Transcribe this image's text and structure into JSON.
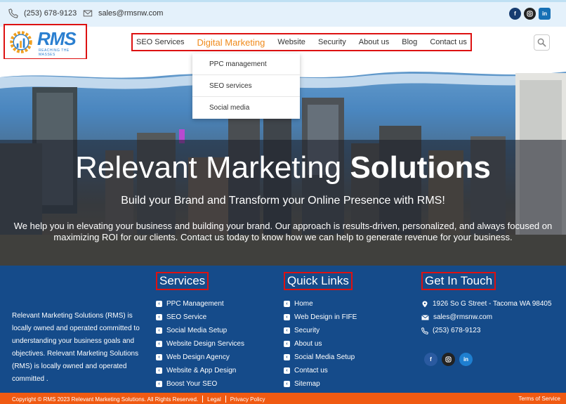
{
  "topbar": {
    "phone": "(253) 678-9123",
    "email": "sales@rmsnw.com",
    "socials": [
      "facebook-icon",
      "instagram-icon",
      "linkedin-icon"
    ]
  },
  "logo": {
    "text": "RMS",
    "tagline": "REACHING THE MASSES"
  },
  "nav": {
    "items": [
      "SEO Services",
      "Digital Marketing",
      "Website",
      "Security",
      "About us",
      "Blog",
      "Contact us"
    ],
    "active": "Digital Marketing"
  },
  "dropdown": {
    "items": [
      "PPC management",
      "SEO services",
      "Social media"
    ]
  },
  "hero": {
    "title_light": "Relevant Marketing",
    "title_bold": "Solutions",
    "subtitle": "Build your Brand and Transform your Online Presence with RMS!",
    "description": "We help you in elevating your business and building your brand. Our approach is results-driven, personalized, and always focused on maximizing ROI for our clients. Contact us today to know how we can help to generate revenue for your business."
  },
  "footer": {
    "about": "Relevant Marketing Solutions (RMS) is locally owned and operated committed to understanding your business goals and objectives. Relevant Marketing Solutions (RMS) is locally owned and operated committed .",
    "services": {
      "heading": "Services",
      "items": [
        "PPC Management",
        "SEO Service",
        "Social Media Setup",
        "Website Design Services",
        "Web Design Agency",
        "Website & App Design",
        "Boost Your SEO"
      ]
    },
    "quick_links": {
      "heading": "Quick Links",
      "items": [
        "Home",
        "Web Design in FIFE",
        "Security",
        "About us",
        "Social Media Setup",
        "Contact us",
        "Sitemap"
      ]
    },
    "contact": {
      "heading": "Get In Touch",
      "address": "1926 So G Street - Tacoma WA 98405",
      "email": "sales@rmsnw.com",
      "phone": "(253) 678-9123"
    }
  },
  "bottombar": {
    "copyright": "Copyright © RMS 2023 Relevant Marketing Solutions. All Rights Reserved.",
    "legal": "Legal",
    "privacy": "Privacy Policy",
    "terms": "Terms of Service"
  },
  "colors": {
    "accent": "#f08a1c",
    "footer_bg": "#154b8a",
    "bottom_bar": "#f05a12",
    "highlight_border": "#dd1111"
  }
}
